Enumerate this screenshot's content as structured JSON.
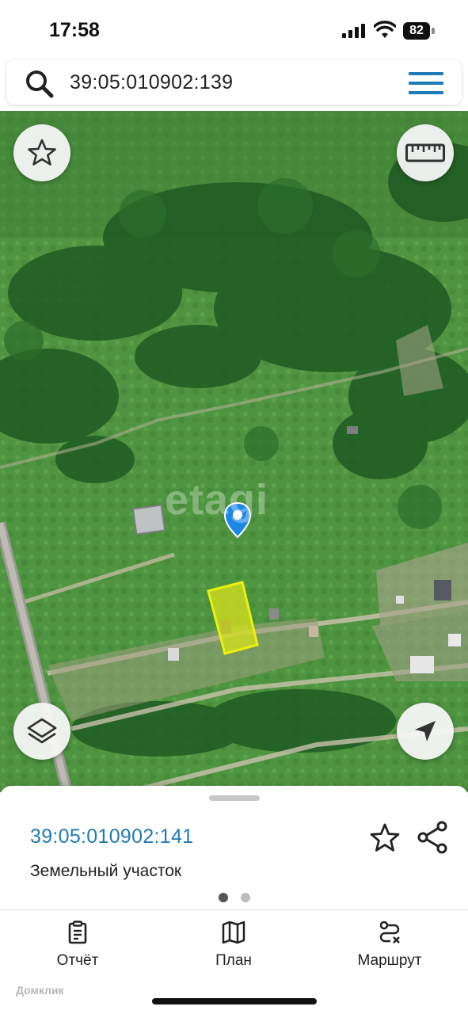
{
  "status_bar": {
    "time": "17:58",
    "battery": "82"
  },
  "search": {
    "query": "39:05:010902:139"
  },
  "map": {
    "watermark": "etagi"
  },
  "sheet": {
    "cadastral_number": "39:05:010902:141",
    "parcel_type": "Земельный участок",
    "page_indicator": {
      "count": 2,
      "active": 0
    }
  },
  "nav": {
    "items": [
      {
        "label": "Отчёт",
        "icon": "report-icon"
      },
      {
        "label": "План",
        "icon": "map-plan-icon"
      },
      {
        "label": "Маршрут",
        "icon": "route-icon"
      }
    ]
  },
  "brand": {
    "watermark": "Домклик"
  },
  "colors": {
    "accent": "#1f7ab8",
    "pin": "#1e88e5",
    "parcel": "#e8f000"
  }
}
